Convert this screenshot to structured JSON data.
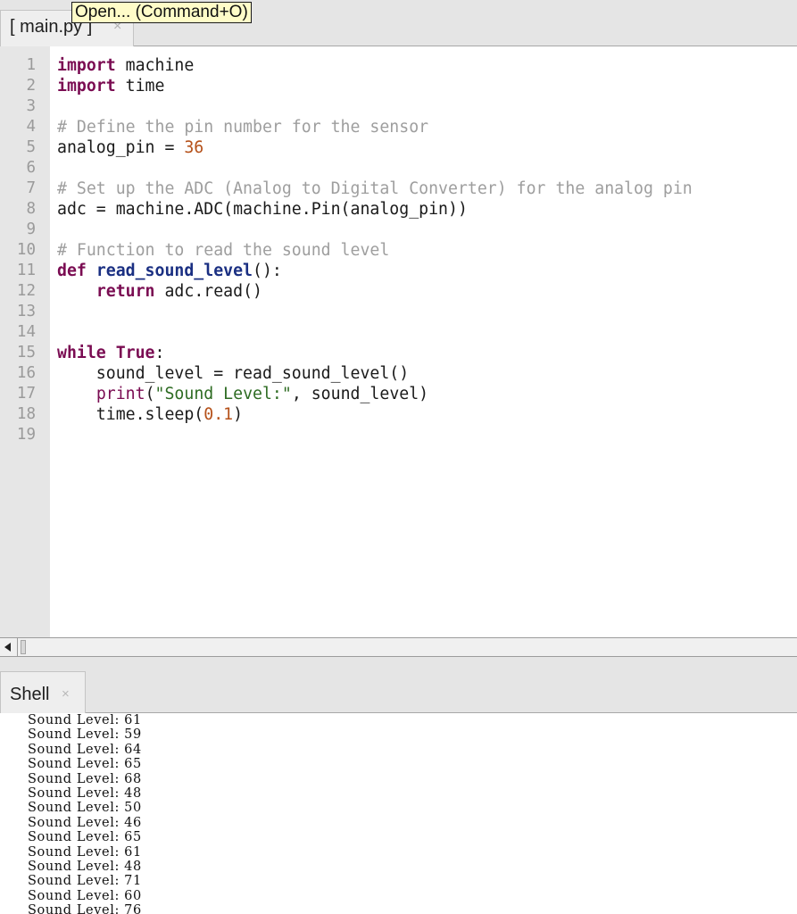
{
  "editor_tab": {
    "label": "[ main.py ]",
    "close_glyph": "×"
  },
  "tooltip": {
    "text": "Open... (Command+O)"
  },
  "editor": {
    "lines": [
      {
        "n": "1",
        "tokens": [
          {
            "t": "import",
            "c": "kw"
          },
          {
            "t": " machine",
            "c": "plain"
          }
        ]
      },
      {
        "n": "2",
        "tokens": [
          {
            "t": "import",
            "c": "kw"
          },
          {
            "t": " time",
            "c": "plain"
          }
        ]
      },
      {
        "n": "3",
        "tokens": []
      },
      {
        "n": "4",
        "tokens": [
          {
            "t": "# Define the pin number for the sensor",
            "c": "com"
          }
        ]
      },
      {
        "n": "5",
        "tokens": [
          {
            "t": "analog_pin = ",
            "c": "plain"
          },
          {
            "t": "36",
            "c": "num"
          }
        ]
      },
      {
        "n": "6",
        "tokens": []
      },
      {
        "n": "7",
        "tokens": [
          {
            "t": "# Set up the ADC (Analog to Digital Converter) for the analog pin",
            "c": "com"
          }
        ]
      },
      {
        "n": "8",
        "tokens": [
          {
            "t": "adc = machine.ADC(machine.Pin(analog_pin))",
            "c": "plain"
          }
        ]
      },
      {
        "n": "9",
        "tokens": []
      },
      {
        "n": "10",
        "tokens": [
          {
            "t": "# Function to read the sound level",
            "c": "com"
          }
        ]
      },
      {
        "n": "11",
        "tokens": [
          {
            "t": "def",
            "c": "kw"
          },
          {
            "t": " ",
            "c": "plain"
          },
          {
            "t": "read_sound_level",
            "c": "fn"
          },
          {
            "t": "():",
            "c": "plain"
          }
        ]
      },
      {
        "n": "12",
        "tokens": [
          {
            "t": "    ",
            "c": "plain"
          },
          {
            "t": "return",
            "c": "kw"
          },
          {
            "t": " adc.read()",
            "c": "plain"
          }
        ]
      },
      {
        "n": "13",
        "tokens": []
      },
      {
        "n": "14",
        "tokens": []
      },
      {
        "n": "15",
        "tokens": [
          {
            "t": "while",
            "c": "kw"
          },
          {
            "t": " ",
            "c": "plain"
          },
          {
            "t": "True",
            "c": "kw"
          },
          {
            "t": ":",
            "c": "plain"
          }
        ]
      },
      {
        "n": "16",
        "tokens": [
          {
            "t": "    sound_level = read_sound_level()",
            "c": "plain"
          }
        ]
      },
      {
        "n": "17",
        "tokens": [
          {
            "t": "    ",
            "c": "plain"
          },
          {
            "t": "print",
            "c": "builtin"
          },
          {
            "t": "(",
            "c": "plain"
          },
          {
            "t": "\"Sound Level:\"",
            "c": "str"
          },
          {
            "t": ", sound_level)",
            "c": "plain"
          }
        ]
      },
      {
        "n": "18",
        "tokens": [
          {
            "t": "    time.sleep(",
            "c": "plain"
          },
          {
            "t": "0.1",
            "c": "num"
          },
          {
            "t": ")",
            "c": "plain"
          }
        ]
      },
      {
        "n": "19",
        "tokens": []
      }
    ]
  },
  "colors": {
    "keyword": "#7a0c52",
    "function_name": "#1a2f82",
    "comment": "#9e9e9e",
    "number": "#b5511a",
    "string": "#2d6b22",
    "gutter_bg": "#e6e6e6",
    "tooltip_bg": "#fffcc8"
  },
  "scrollbar": {
    "left_arrow_icon": "triangle-left-icon"
  },
  "shell_tab": {
    "label": "Shell",
    "close_glyph": "×"
  },
  "shell": {
    "prefix": "Sound Level:",
    "values": [
      "61",
      "59",
      "64",
      "65",
      "68",
      "48",
      "50",
      "46",
      "65",
      "61",
      "48",
      "71",
      "60",
      "76"
    ]
  }
}
